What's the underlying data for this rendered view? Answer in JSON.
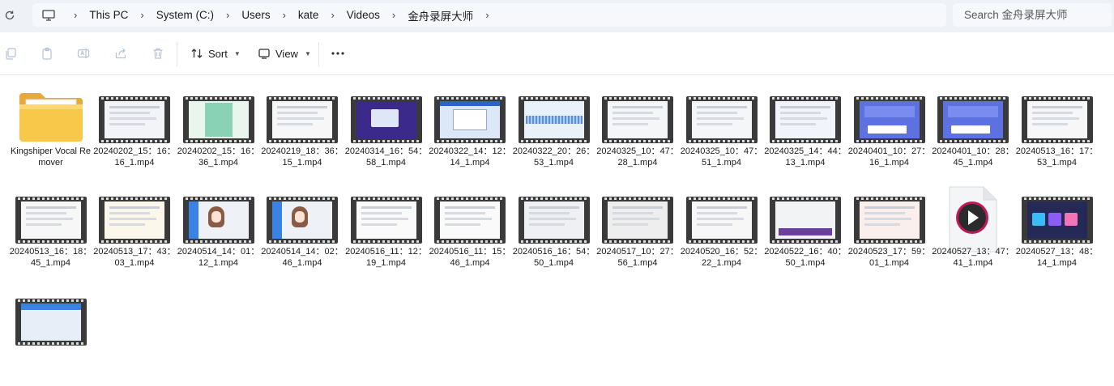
{
  "address": {
    "breadcrumbs": [
      "This PC",
      "System (C:)",
      "Users",
      "kate",
      "Videos",
      "金舟录屏大师"
    ]
  },
  "search": {
    "placeholder": "Search 金舟录屏大师"
  },
  "toolbar": {
    "sort_label": "Sort",
    "view_label": "View"
  },
  "icons": {
    "refresh": "refresh-icon",
    "pc": "computer-icon",
    "chevron": "chevron-right-icon",
    "copy": "copy-icon",
    "paste": "paste-icon",
    "rename": "rename-icon",
    "share": "share-icon",
    "delete": "delete-icon",
    "sort": "sort-icon",
    "view": "view-icon",
    "more": "more-icon",
    "folder": "folder-icon",
    "video": "video-file-icon",
    "play": "play-icon"
  },
  "items": [
    {
      "name": "Kingshiper Vocal Remover",
      "kind": "folder"
    },
    {
      "name": "20240202_15：16：16_1.mp4",
      "kind": "video",
      "thumb": "light"
    },
    {
      "name": "20240202_15：16：36_1.mp4",
      "kind": "video",
      "thumb": "green"
    },
    {
      "name": "20240219_18：36：15_1.mp4",
      "kind": "video",
      "thumb": "doc"
    },
    {
      "name": "20240314_16：54：58_1.mp4",
      "kind": "video",
      "thumb": "purple"
    },
    {
      "name": "20240322_14：12：14_1.mp4",
      "kind": "video",
      "thumb": "blue"
    },
    {
      "name": "20240322_20：26：53_1.mp4",
      "kind": "video",
      "thumb": "wave"
    },
    {
      "name": "20240325_10：47：28_1.mp4",
      "kind": "video",
      "thumb": "table"
    },
    {
      "name": "20240325_10：47：51_1.mp4",
      "kind": "video",
      "thumb": "table"
    },
    {
      "name": "20240325_14：44：13_1.mp4",
      "kind": "video",
      "thumb": "table2"
    },
    {
      "name": "20240401_10：27：16_1.mp4",
      "kind": "video",
      "thumb": "site"
    },
    {
      "name": "20240401_10：28：45_1.mp4",
      "kind": "video",
      "thumb": "site"
    },
    {
      "name": "20240513_16：17：53_1.mp4",
      "kind": "video",
      "thumb": "doc"
    },
    {
      "name": "20240513_16：18：45_1.mp4",
      "kind": "video",
      "thumb": "doc"
    },
    {
      "name": "20240513_17：43：03_1.mp4",
      "kind": "video",
      "thumb": "yellow"
    },
    {
      "name": "20240514_14：01：12_1.mp4",
      "kind": "video",
      "thumb": "anime"
    },
    {
      "name": "20240514_14：02：46_1.mp4",
      "kind": "video",
      "thumb": "anime"
    },
    {
      "name": "20240516_11：12：19_1.mp4",
      "kind": "video",
      "thumb": "sketch"
    },
    {
      "name": "20240516_11：15：46_1.mp4",
      "kind": "video",
      "thumb": "sketch"
    },
    {
      "name": "20240516_16：54：50_1.mp4",
      "kind": "video",
      "thumb": "web"
    },
    {
      "name": "20240517_10：27：56_1.mp4",
      "kind": "video",
      "thumb": "dialog"
    },
    {
      "name": "20240520_16：52：22_1.mp4",
      "kind": "video",
      "thumb": "doc"
    },
    {
      "name": "20240522_16：40：50_1.mp4",
      "kind": "video",
      "thumb": "dark"
    },
    {
      "name": "20240523_17：59：01_1.mp4",
      "kind": "video",
      "thumb": "pink"
    },
    {
      "name": "20240527_13：47：41_1.mp4",
      "kind": "media"
    },
    {
      "name": "20240527_13：48：14_1.mp4",
      "kind": "video",
      "thumb": "promo"
    },
    {
      "name": "",
      "kind": "video",
      "thumb": "bluepanel"
    }
  ]
}
